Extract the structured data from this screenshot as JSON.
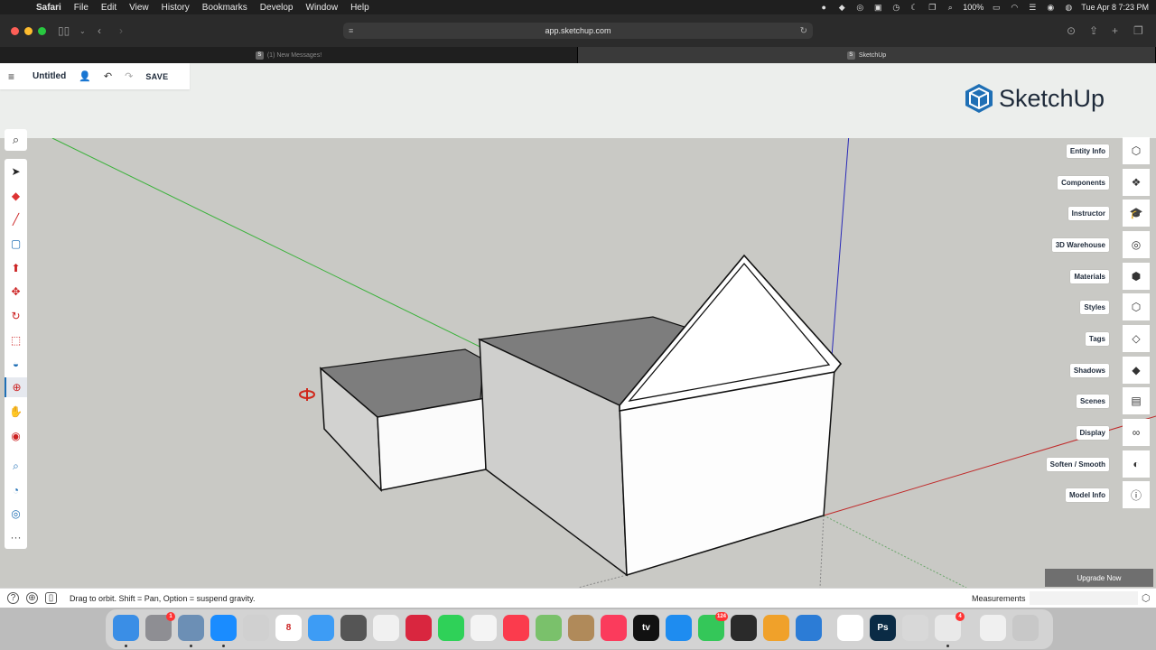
{
  "menubar": {
    "app_name": "Safari",
    "menus": [
      "File",
      "Edit",
      "View",
      "History",
      "Bookmarks",
      "Develop",
      "Window",
      "Help"
    ],
    "battery": "100%",
    "datetime": "Tue Apr 8  7:23 PM"
  },
  "safari": {
    "url": "app.sketchup.com",
    "tabs": [
      {
        "label": "(1) New Messages!",
        "active": false
      },
      {
        "label": "SketchUp",
        "active": true
      }
    ]
  },
  "sketchup": {
    "file_title": "Untitled",
    "save_label": "SAVE",
    "logo_text": "SketchUp",
    "panels": [
      {
        "label": "Entity Info",
        "icon": "entity-info-icon"
      },
      {
        "label": "Components",
        "icon": "components-icon"
      },
      {
        "label": "Instructor",
        "icon": "instructor-icon"
      },
      {
        "label": "3D Warehouse",
        "icon": "warehouse-icon"
      },
      {
        "label": "Materials",
        "icon": "materials-icon"
      },
      {
        "label": "Styles",
        "icon": "styles-icon"
      },
      {
        "label": "Tags",
        "icon": "tags-icon"
      },
      {
        "label": "Shadows",
        "icon": "shadows-icon"
      },
      {
        "label": "Scenes",
        "icon": "scenes-icon"
      },
      {
        "label": "Display",
        "icon": "display-icon"
      },
      {
        "label": "Soften / Smooth",
        "icon": "soften-smooth-icon"
      },
      {
        "label": "Model Info",
        "icon": "model-info-icon"
      }
    ],
    "tools": [
      "select",
      "eraser",
      "line",
      "rectangle",
      "push-pull",
      "move",
      "rotate",
      "scale",
      "paint-bucket",
      "orbit",
      "pan",
      "position-camera",
      "zoom",
      "walk",
      "look-around",
      "more"
    ],
    "active_tool": "orbit",
    "upgrade_label": "Upgrade Now",
    "status_hint": "Drag to orbit. Shift = Pan, Option = suspend gravity.",
    "measurements_label": "Measurements"
  },
  "dock": {
    "apps": [
      {
        "name": "Finder",
        "color": "#3a8ee6",
        "glyph": "",
        "running": true
      },
      {
        "name": "System Settings",
        "color": "#8e8e93",
        "glyph": "",
        "badge": "1",
        "running": false
      },
      {
        "name": "Preview",
        "color": "#6c8fb5",
        "glyph": "",
        "running": true
      },
      {
        "name": "Safari",
        "color": "#1a8cff",
        "glyph": "",
        "running": true
      },
      {
        "name": "Launchpad",
        "color": "#d0d0d0",
        "glyph": "",
        "running": false
      },
      {
        "name": "Calendar",
        "color": "#ffffff",
        "glyph": "8",
        "running": false
      },
      {
        "name": "Mail",
        "color": "#3d9cf5",
        "glyph": "",
        "running": false
      },
      {
        "name": "Calculator",
        "color": "#555555",
        "glyph": "",
        "running": false
      },
      {
        "name": "Chrome",
        "color": "#f1f1f1",
        "glyph": "",
        "running": false
      },
      {
        "name": "Quip",
        "color": "#d9263f",
        "glyph": "",
        "running": false
      },
      {
        "name": "FaceTime",
        "color": "#2fd158",
        "glyph": "",
        "running": false
      },
      {
        "name": "Photos",
        "color": "#f4f4f4",
        "glyph": "",
        "running": false
      },
      {
        "name": "News",
        "color": "#fb3b4d",
        "glyph": "",
        "running": false
      },
      {
        "name": "Maps",
        "color": "#7ac16b",
        "glyph": "",
        "running": false
      },
      {
        "name": "Contacts",
        "color": "#b08a5a",
        "glyph": "",
        "running": false
      },
      {
        "name": "Music",
        "color": "#fb3b5c",
        "glyph": "",
        "running": false
      },
      {
        "name": "TV",
        "color": "#111111",
        "glyph": "tv",
        "running": false
      },
      {
        "name": "App Store",
        "color": "#1e8cf0",
        "glyph": "",
        "running": false
      },
      {
        "name": "Messages",
        "color": "#34c759",
        "glyph": "",
        "badge": "124",
        "running": false
      },
      {
        "name": "DaVinci Resolve",
        "color": "#2a2a2a",
        "glyph": "",
        "running": false
      },
      {
        "name": "VPN",
        "color": "#f0a12a",
        "glyph": "",
        "running": false
      },
      {
        "name": "Activity",
        "color": "#2c7cd6",
        "glyph": "",
        "running": false
      },
      {
        "name": "Numbers",
        "color": "#ffffff",
        "glyph": "",
        "running": false
      },
      {
        "name": "Photoshop",
        "color": "#0a2b45",
        "glyph": "Ps",
        "running": false
      },
      {
        "name": "Utility",
        "color": "#d8d8d8",
        "glyph": "",
        "running": false
      },
      {
        "name": "Shortcuts",
        "color": "#e9e9e9",
        "glyph": "",
        "badge": "4",
        "running": true
      },
      {
        "name": "Documents",
        "color": "#f0f0f0",
        "glyph": "",
        "running": false
      },
      {
        "name": "Trash",
        "color": "#c8c8c8",
        "glyph": "",
        "running": false
      }
    ]
  }
}
